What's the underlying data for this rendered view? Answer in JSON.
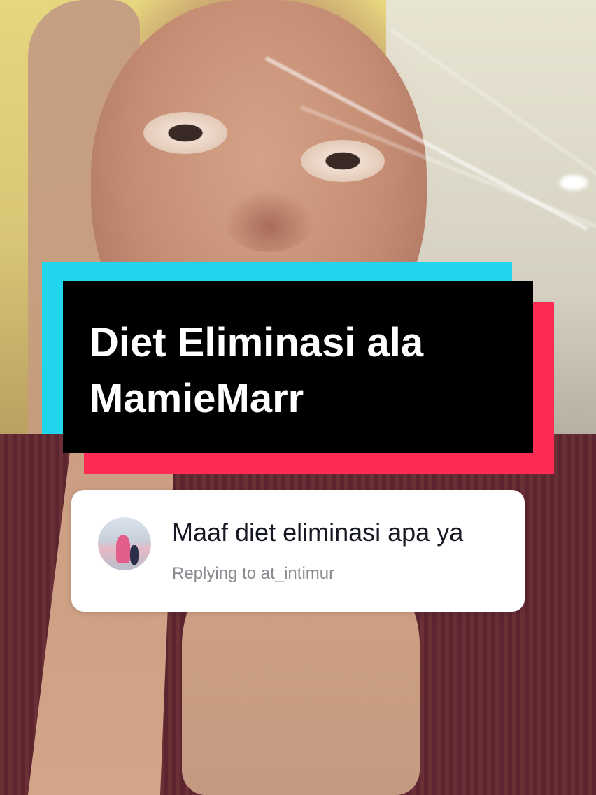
{
  "title_card": {
    "text": "Diet Eliminasi ala\nMamieMarr",
    "colors": {
      "panel": "#000000",
      "accent_cyan": "#20d5ec",
      "accent_red": "#fe2c55",
      "text": "#ffffff"
    }
  },
  "reply": {
    "comment": "Maaf diet eliminasi apa ya",
    "replying_to": "Replying to at_intimur",
    "avatar_icon": "user-avatar"
  }
}
